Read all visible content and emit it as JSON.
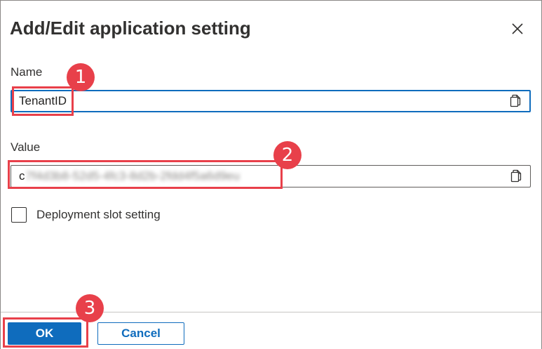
{
  "dialog": {
    "title": "Add/Edit application setting"
  },
  "fields": {
    "name": {
      "label": "Name",
      "value": "TenantID"
    },
    "value": {
      "label": "Value",
      "value_visible_prefix": "c",
      "value_obscured": "7f4d3b8-52d5-4fc3-8d2b-2fdd4f5a6d9eu"
    }
  },
  "options": {
    "deployment_slot_label": "Deployment slot setting",
    "deployment_slot_checked": false
  },
  "footer": {
    "ok_label": "OK",
    "cancel_label": "Cancel"
  },
  "annotations": {
    "badge_1": "1",
    "badge_2": "2",
    "badge_3": "3"
  },
  "colors": {
    "accent": "#0f6cbd",
    "annotation": "#e8404a"
  },
  "icons": {
    "close": "close-icon",
    "copy": "copy-icon"
  }
}
